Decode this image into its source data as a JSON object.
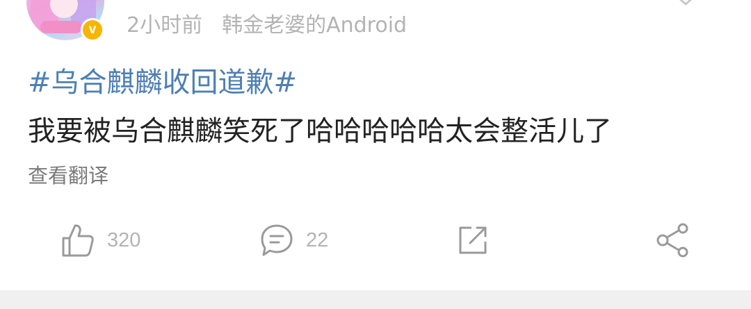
{
  "post": {
    "time": "2小时前",
    "source": "韩金老婆的Android",
    "verified_badge": "v",
    "topic": "#乌合麒麟收回道歉#",
    "text": "我要被乌合麒麟笑死了哈哈哈哈哈太会整活儿了",
    "translate_label": "查看翻译"
  },
  "actions": {
    "like_count": "320",
    "comment_count": "22"
  },
  "icons": {
    "like": "thumbs-up-icon",
    "comment": "comment-bubble-icon",
    "repost": "repost-arrow-icon",
    "share": "share-nodes-icon",
    "menu": "chevron-down-icon"
  },
  "colors": {
    "topic": "#4e7fb3",
    "text": "#222222",
    "meta": "#b3b3b3",
    "badge": "#f7b500",
    "icon": "#9a9a9a"
  }
}
